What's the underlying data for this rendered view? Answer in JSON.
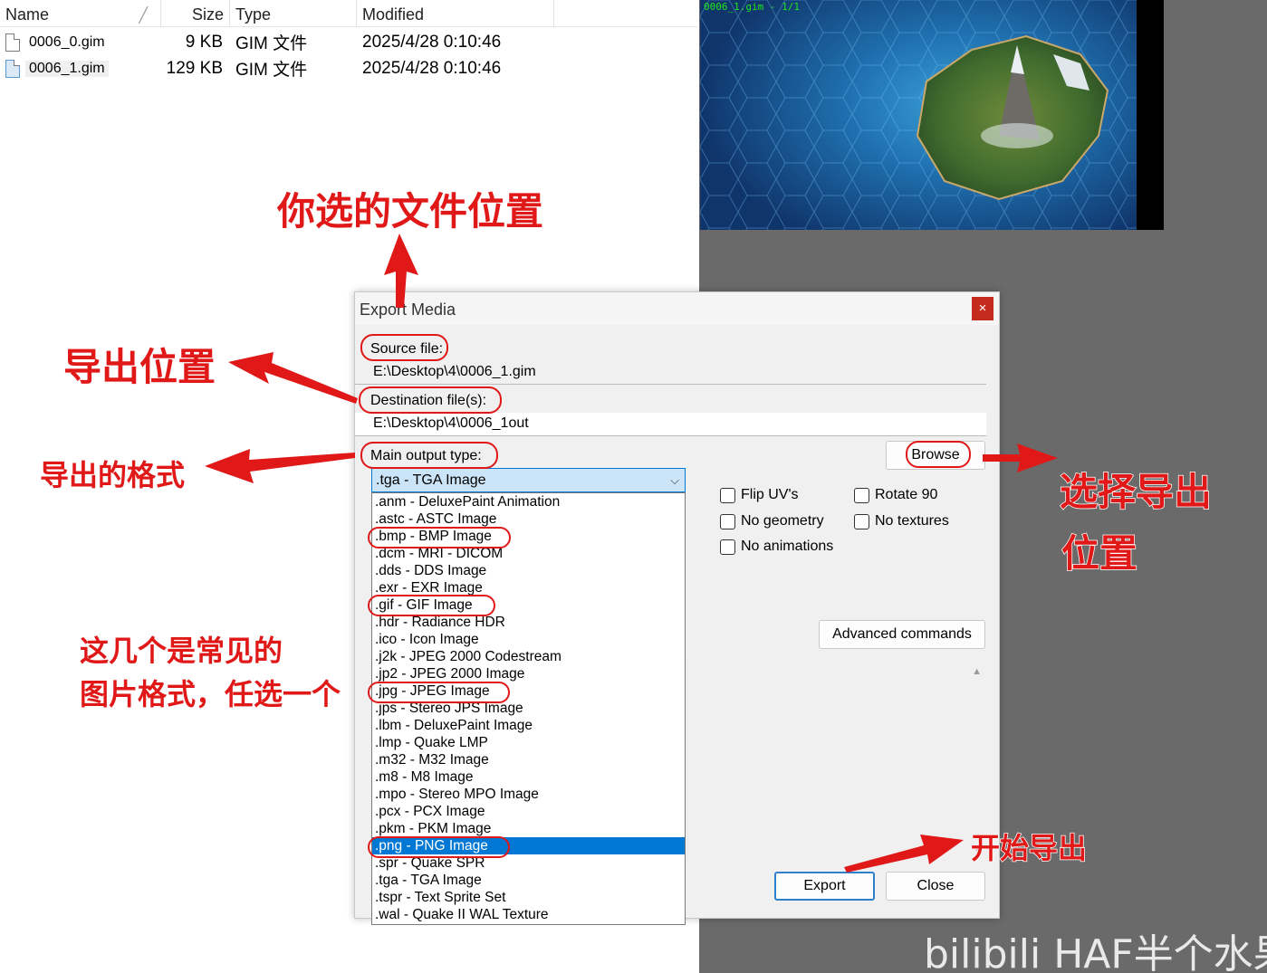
{
  "explorer": {
    "columns": {
      "name": "Name",
      "size": "Size",
      "type": "Type",
      "modified": "Modified"
    },
    "files": [
      {
        "name": "0006_0.gim",
        "size": "9 KB",
        "type": "GIM 文件",
        "modified": "2025/4/28 0:10:46"
      },
      {
        "name": "0006_1.gim",
        "size": "129 KB",
        "type": "GIM 文件",
        "modified": "2025/4/28 0:10:46"
      }
    ]
  },
  "viewport": {
    "label": "0006_1.gim - 1/1"
  },
  "dialog": {
    "title": "Export Media",
    "close_symbol": "×",
    "source_label": "Source file:",
    "source_value": "E:\\Desktop\\4\\0006_1.gim",
    "destination_label": "Destination file(s):",
    "destination_value": "E:\\Desktop\\4\\0006_1out",
    "browse_label": "Browse",
    "output_type_label": "Main output type:",
    "output_type_selected": ".tga - TGA Image",
    "output_types": [
      ".anm - DeluxePaint Animation",
      ".astc - ASTC Image",
      ".bmp - BMP Image",
      ".dcm - MRI - DICOM",
      ".dds - DDS Image",
      ".exr - EXR Image",
      ".gif - GIF Image",
      ".hdr - Radiance HDR",
      ".ico - Icon Image",
      ".j2k - JPEG 2000 Codestream",
      ".jp2 - JPEG 2000 Image",
      ".jpg - JPEG Image",
      ".jps - Stereo JPS Image",
      ".lbm - DeluxePaint Image",
      ".lmp - Quake LMP",
      ".m32 - M32 Image",
      ".m8 - M8 Image",
      ".mpo - Stereo MPO Image",
      ".pcx - PCX Image",
      ".pkm - PKM Image",
      ".png - PNG Image",
      ".spr - Quake SPR",
      ".tga - TGA Image",
      ".tspr - Text Sprite Set",
      ".wal - Quake II WAL Texture"
    ],
    "highlighted_type": ".png - PNG Image",
    "options": {
      "flip_uvs": "Flip UV's",
      "rotate_90": "Rotate 90",
      "no_geometry": "No geometry",
      "no_textures": "No textures",
      "no_animations": "No animations"
    },
    "advanced_label": "Advanced commands",
    "export_label": "Export",
    "close_label": "Close"
  },
  "annotations": {
    "file_location": "你选的文件位置",
    "export_location": "导出位置",
    "export_format": "导出的格式",
    "choose_location_line1": "选择导出",
    "choose_location_line2": "位置",
    "common_formats_line1": "这几个是常见的",
    "common_formats_line2": "图片格式，任选一个",
    "start_export": "开始导出"
  },
  "watermark": "bilibili HAF半个水果",
  "colors": {
    "annotation_red": "#e01818",
    "selection_blue": "#0078d4",
    "close_red": "#c42b1c"
  }
}
